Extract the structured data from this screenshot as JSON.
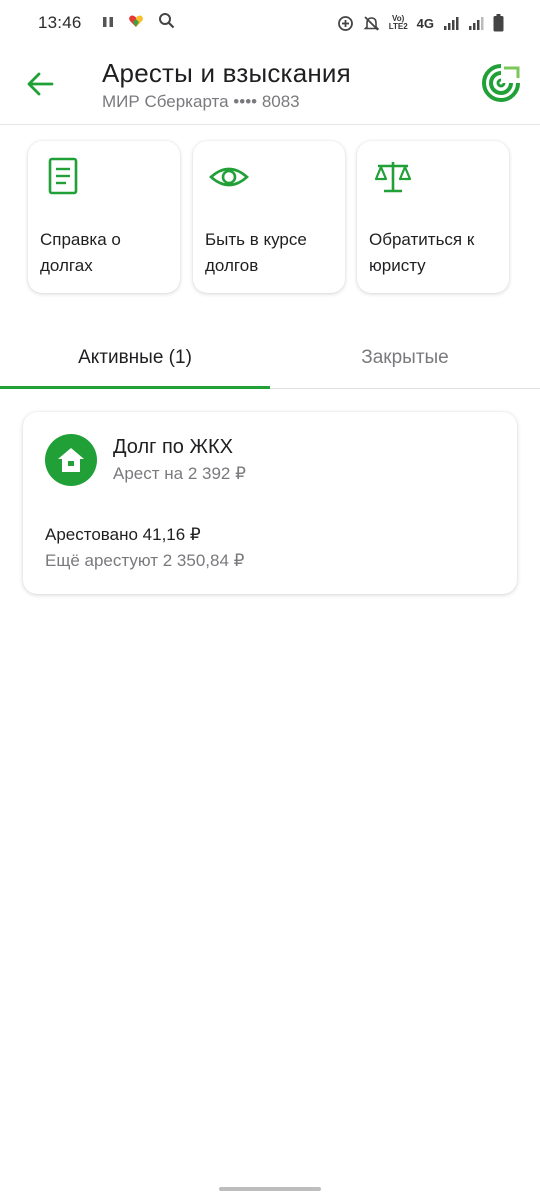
{
  "status_bar": {
    "time": "13:46",
    "lte_top": "Vo)",
    "lte_bottom": "LTE2",
    "network": "4G"
  },
  "header": {
    "title": "Аресты и взыскания",
    "subtitle": "МИР Сберкарта •••• 8083",
    "back_icon": "arrow-left-icon",
    "logo_icon": "sber-logo-icon"
  },
  "actions": [
    {
      "label": "Справка о долгах",
      "icon": "document-icon"
    },
    {
      "label": "Быть в курсе долгов",
      "icon": "eye-icon"
    },
    {
      "label": "Обратиться к юристу",
      "icon": "scales-icon"
    }
  ],
  "tabs": [
    {
      "label": "Активные (1)",
      "active": true
    },
    {
      "label": "Закрытые",
      "active": false
    }
  ],
  "debt": {
    "title": "Долг по ЖКХ",
    "subtitle": "Арест на 2 392 ₽",
    "arrested": "Арестовано 41,16 ₽",
    "remaining": "Ещё арестуют 2 350,84 ₽",
    "icon": "house-icon"
  },
  "colors": {
    "accent": "#21a038",
    "text_primary": "#1f1f22",
    "text_secondary": "#7a7a7e"
  }
}
